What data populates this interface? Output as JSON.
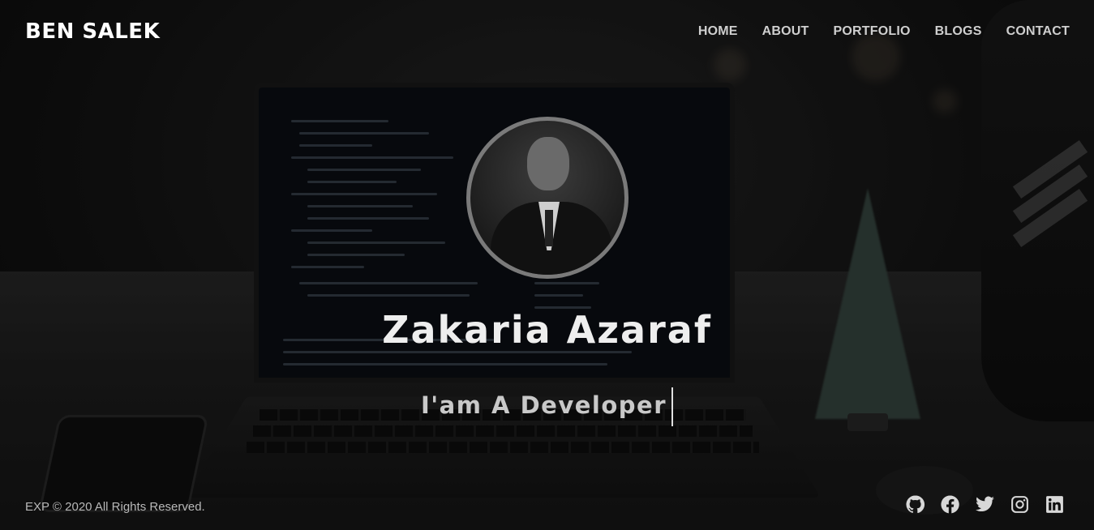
{
  "header": {
    "brand": "BEN SALEK",
    "nav": [
      {
        "label": "HOME"
      },
      {
        "label": "ABOUT"
      },
      {
        "label": "PORTFOLIO"
      },
      {
        "label": "BLOGS"
      },
      {
        "label": "CONTACT"
      }
    ]
  },
  "hero": {
    "avatar_icon": "profile-photo",
    "name": "Zakaria Azaraf",
    "tagline": "I'am A Developer"
  },
  "footer": {
    "copyright": "EXP © 2020 All Rights Reserved.",
    "socials": [
      {
        "icon": "github-icon"
      },
      {
        "icon": "facebook-icon"
      },
      {
        "icon": "twitter-icon"
      },
      {
        "icon": "instagram-icon"
      },
      {
        "icon": "linkedin-icon"
      }
    ]
  },
  "colors": {
    "overlay": "#000000",
    "text": "#ffffff",
    "nav_text": "#cfcfcf",
    "avatar_border": "#7a7a7a"
  }
}
